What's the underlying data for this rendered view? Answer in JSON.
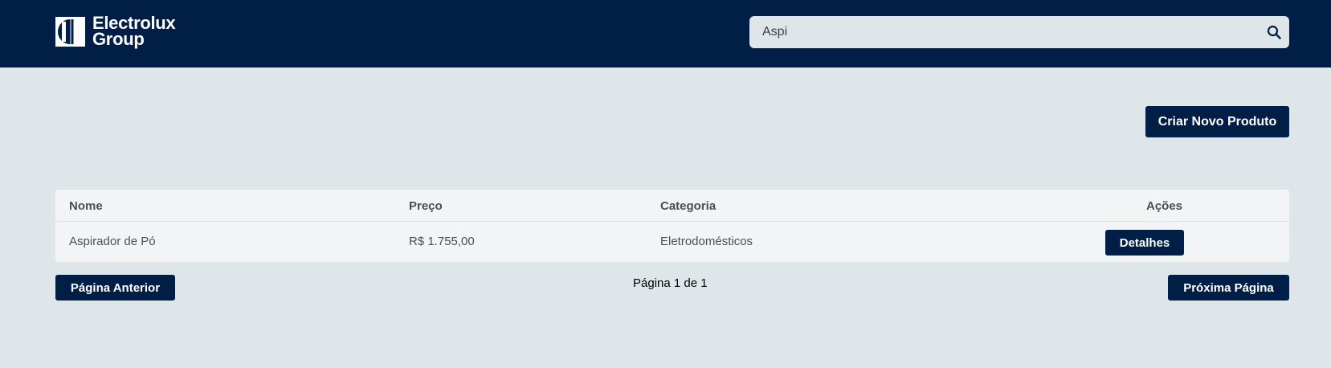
{
  "header": {
    "logo": {
      "line1": "Electrolux",
      "line2": "Group"
    },
    "search": {
      "value": "Aspi",
      "icon": "search-icon"
    }
  },
  "toolbar": {
    "create_label": "Criar Novo Produto"
  },
  "table": {
    "columns": [
      "Nome",
      "Preço",
      "Categoria",
      "Ações"
    ],
    "rows": [
      {
        "name": "Aspirador de Pó",
        "price": "R$ 1.755,00",
        "category": "Eletrodomésticos",
        "action_label": "Detalhes"
      }
    ]
  },
  "pagination": {
    "prev_label": "Página Anterior",
    "info": "Página 1 de 1",
    "next_label": "Próxima Página"
  },
  "colors": {
    "header_bg": "#011e46",
    "page_bg": "#dfe6ea",
    "button_bg": "#011e46",
    "table_bg": "#f2f4f6"
  }
}
